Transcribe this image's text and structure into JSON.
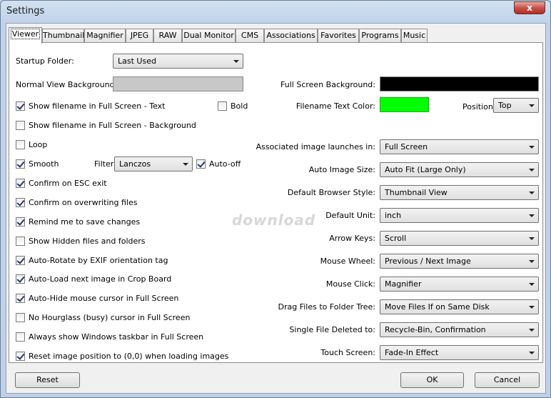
{
  "window": {
    "title": "Settings",
    "close_glyph": "x"
  },
  "tabs": [
    "Viewer",
    "Thumbnail",
    "Magnifier",
    "JPEG",
    "RAW",
    "Dual Monitor",
    "CMS",
    "Associations",
    "Favorites",
    "Programs",
    "Music"
  ],
  "left": {
    "startup_folder_label": "Startup Folder:",
    "startup_folder_value": "Last Used",
    "normal_bg_label": "Normal View Background:",
    "show_filename_text": "Show filename in Full Screen - Text",
    "bold": "Bold",
    "show_filename_bg": "Show filename in Full Screen - Background",
    "loop": "Loop",
    "smooth": "Smooth",
    "filter_label": "Filter:",
    "filter_value": "Lanczos",
    "auto_off": "Auto-off",
    "confirm_esc": "Confirm on ESC exit",
    "confirm_overwrite": "Confirm on overwriting files",
    "remind_save": "Remind me to save changes",
    "show_hidden": "Show Hidden files and folders",
    "auto_rotate": "Auto-Rotate by EXIF orientation tag",
    "auto_load": "Auto-Load next image in Crop Board",
    "auto_hide": "Auto-Hide mouse cursor in Full Screen",
    "no_hourglass": "No Hourglass (busy) cursor in Full Screen",
    "always_taskbar": "Always show Windows taskbar in Full Screen",
    "reset_position": "Reset image position to (0,0) when loading images"
  },
  "right": {
    "full_bg_label": "Full Screen Background:",
    "filename_color_label": "Filename Text Color:",
    "position_label": "Position:",
    "position_value": "Top",
    "rows": [
      {
        "label": "Associated image launches in:",
        "value": "Full Screen"
      },
      {
        "label": "Auto Image Size:",
        "value": "Auto Fit (Large Only)"
      },
      {
        "label": "Default Browser Style:",
        "value": "Thumbnail View"
      },
      {
        "label": "Default Unit:",
        "value": "inch"
      },
      {
        "label": "Arrow Keys:",
        "value": "Scroll"
      },
      {
        "label": "Mouse Wheel:",
        "value": "Previous / Next Image"
      },
      {
        "label": "Mouse Click:",
        "value": "Magnifier"
      },
      {
        "label": "Drag Files to Folder Tree:",
        "value": "Move Files If on Same Disk"
      },
      {
        "label": "Single File Deleted to:",
        "value": "Recycle-Bin, Confirmation"
      },
      {
        "label": "Touch Screen:",
        "value": "Fade-In Effect"
      }
    ]
  },
  "colors": {
    "normal_bg": "#c8c8c8",
    "full_bg": "#000000",
    "filename_text": "#00ff00"
  },
  "buttons": {
    "reset": "Reset",
    "ok": "OK",
    "cancel": "Cancel"
  },
  "watermark": "download"
}
